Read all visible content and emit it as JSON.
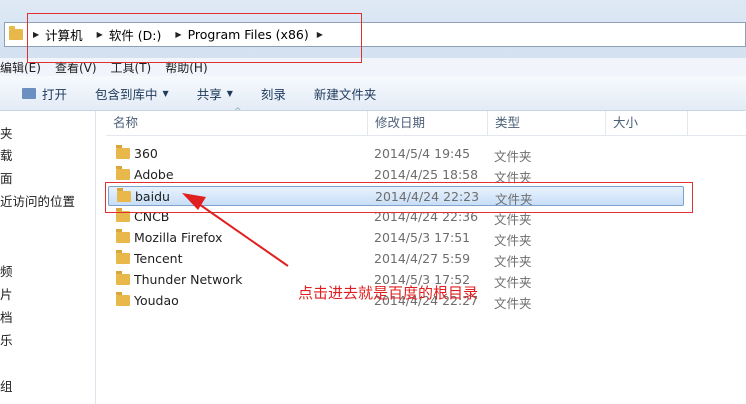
{
  "address": {
    "crumbs": [
      "计算机",
      "软件 (D:)",
      "Program Files (x86)"
    ]
  },
  "menu": [
    "编辑(E)",
    "查看(V)",
    "工具(T)",
    "帮助(H)"
  ],
  "toolbar": {
    "open": "打开",
    "include_library": "包含到库中",
    "share": "共享",
    "burn": "刻录",
    "new_folder": "新建文件夹"
  },
  "nav": [
    "夹",
    "载",
    "面",
    "近访问的位置",
    "频",
    "片",
    "档",
    "乐",
    "组"
  ],
  "columns": {
    "name": "名称",
    "modified": "修改日期",
    "type": "类型",
    "size": "大小"
  },
  "files": [
    {
      "name": "360",
      "date": "2014/5/4 19:45",
      "type": "文件夹"
    },
    {
      "name": "Adobe",
      "date": "2014/4/25 18:58",
      "type": "文件夹"
    },
    {
      "name": "baidu",
      "date": "2014/4/24 22:23",
      "type": "文件夹",
      "selected": true
    },
    {
      "name": "CNCB",
      "date": "2014/4/24 22:36",
      "type": "文件夹"
    },
    {
      "name": "Mozilla Firefox",
      "date": "2014/5/3 17:51",
      "type": "文件夹"
    },
    {
      "name": "Tencent",
      "date": "2014/4/27 5:59",
      "type": "文件夹"
    },
    {
      "name": "Thunder Network",
      "date": "2014/5/3 17:52",
      "type": "文件夹"
    },
    {
      "name": "Youdao",
      "date": "2014/4/24 22:27",
      "type": "文件夹"
    }
  ],
  "annotation": "点击进去就是百度的根目录",
  "colors": {
    "annotation": "#e02020",
    "selection_border": "#7da2ce",
    "folder": "#e8b94a"
  }
}
